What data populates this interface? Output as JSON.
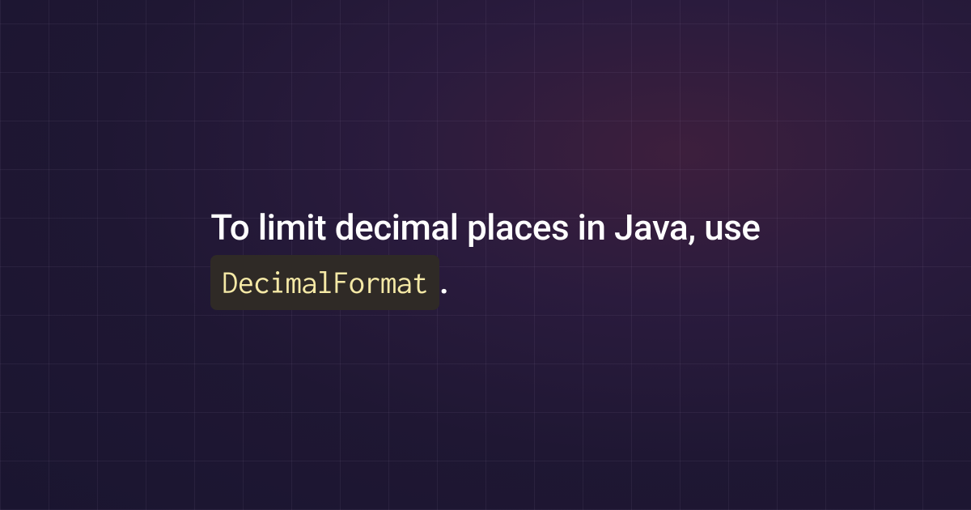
{
  "content": {
    "text_part1": "To limit decimal places in Java, use ",
    "code_snippet": "DecimalFormat",
    "text_part2": "."
  }
}
